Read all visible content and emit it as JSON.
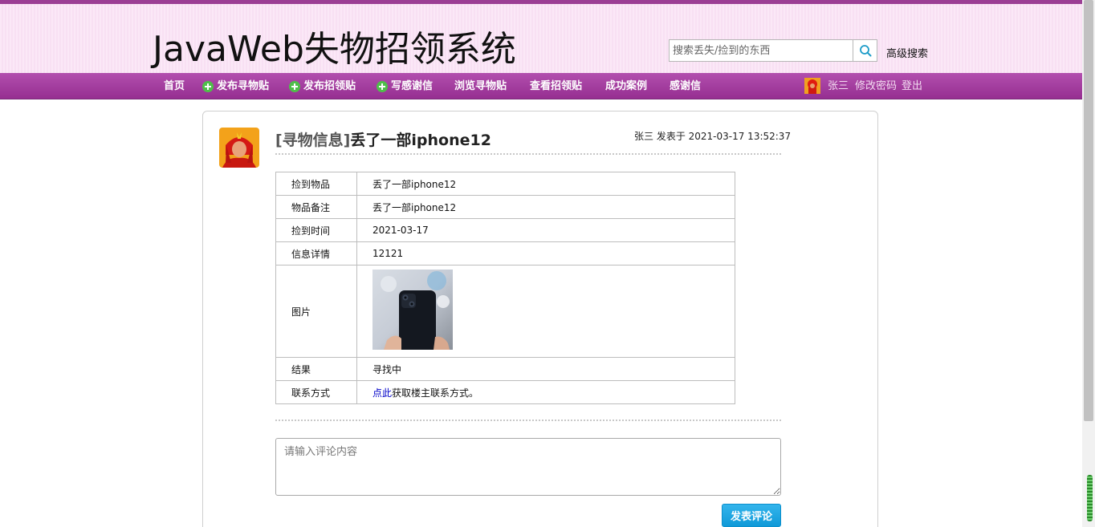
{
  "header": {
    "site_title": "JavaWeb失物招领系统",
    "search_placeholder": "搜索丢失/捡到的东西",
    "search_icon": "search-icon",
    "advanced_search": "高级搜索"
  },
  "nav": {
    "items": [
      {
        "label": "首页",
        "icon": null
      },
      {
        "label": "发布寻物贴",
        "icon": "plus-circle-icon"
      },
      {
        "label": "发布招领贴",
        "icon": "plus-circle-icon"
      },
      {
        "label": "写感谢信",
        "icon": "plus-circle-icon"
      },
      {
        "label": "浏览寻物贴",
        "icon": null
      },
      {
        "label": "查看招领贴",
        "icon": null
      },
      {
        "label": "成功案例",
        "icon": null
      },
      {
        "label": "感谢信",
        "icon": null
      }
    ],
    "user_name": "张三",
    "change_password": "修改密码",
    "logout": "登出"
  },
  "post": {
    "tag": "[寻物信息]",
    "title": "丢了一部iphone12",
    "meta": "张三 发表于  2021-03-17 13:52:37",
    "details": [
      {
        "key": "捡到物品",
        "value": "丢了一部iphone12"
      },
      {
        "key": "物品备注",
        "value": "丢了一部iphone12"
      },
      {
        "key": "捡到时间",
        "value": "2021-03-17"
      },
      {
        "key": "信息详情",
        "value": "12121"
      }
    ],
    "image_label": "图片",
    "result_label": "结果",
    "result_value": "寻找中",
    "contact_label": "联系方式",
    "contact_link": "点此",
    "contact_text": "获取楼主联系方式。"
  },
  "comment": {
    "placeholder": "请输入评论内容",
    "submit_label": "发表评论"
  },
  "colors": {
    "accent_purple": "#a63fa1",
    "header_bg": "#fbe8f7",
    "button_blue": "#1aa6e2"
  }
}
